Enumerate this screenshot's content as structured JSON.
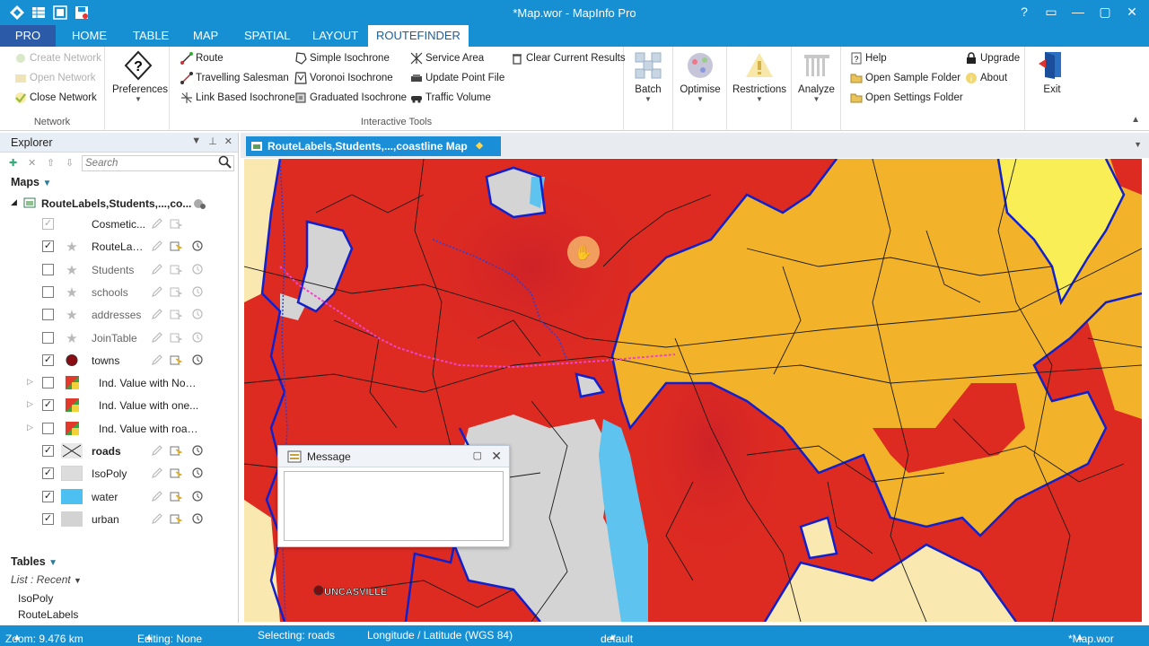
{
  "window": {
    "title": "*Map.wor - MapInfo Pro",
    "controls": [
      "?",
      "▭",
      "—",
      "▢",
      "✕"
    ]
  },
  "ribbon_tabs": [
    {
      "label": "PRO"
    },
    {
      "label": "HOME"
    },
    {
      "label": "TABLE"
    },
    {
      "label": "MAP"
    },
    {
      "label": "SPATIAL"
    },
    {
      "label": "LAYOUT"
    },
    {
      "label": "ROUTEFINDER",
      "active": true
    }
  ],
  "ribbon": {
    "network_group": {
      "label": "Network",
      "items": [
        {
          "label": "Create Network",
          "enabled": false
        },
        {
          "label": "Open Network",
          "enabled": false
        },
        {
          "label": "Close Network",
          "enabled": true
        }
      ]
    },
    "preferences": {
      "label": "Preferences"
    },
    "interactive_tools": {
      "label": "Interactive Tools",
      "col1": [
        "Route",
        "Travelling Salesman",
        "Link Based Isochrone"
      ],
      "col2": [
        "Simple Isochrone",
        "Voronoi Isochrone",
        "Graduated Isochrone"
      ],
      "col3": [
        "Service Area",
        "Update Point File",
        "Traffic Volume"
      ],
      "col4": [
        "Clear Current Results"
      ]
    },
    "big_buttons": [
      "Batch",
      "Optimise",
      "Restrictions",
      "Analyze"
    ],
    "help_group": {
      "col1": [
        "Help",
        "Open Sample Folder",
        "Open Settings Folder"
      ],
      "col2": [
        "Upgrade",
        "About"
      ]
    },
    "exit": {
      "label": "Exit"
    }
  },
  "explorer": {
    "title": "Explorer",
    "search_placeholder": "Search",
    "maps_label": "Maps",
    "map_name": "RouteLabels,Students,...,co...",
    "layers": [
      {
        "name": "Cosmetic...",
        "checked": true,
        "disabled": true,
        "swatch": "none"
      },
      {
        "name": "RouteLab...",
        "checked": true,
        "swatch": "star"
      },
      {
        "name": "Students",
        "checked": false,
        "swatch": "star"
      },
      {
        "name": "schools",
        "checked": false,
        "swatch": "star"
      },
      {
        "name": "addresses",
        "checked": false,
        "swatch": "star"
      },
      {
        "name": "JoinTable",
        "checked": false,
        "swatch": "star"
      },
      {
        "name": "towns",
        "checked": true,
        "swatch": "dot"
      },
      {
        "name": "Ind. Value with NoD...",
        "checked": false,
        "swatch": "theme",
        "theme": true
      },
      {
        "name": "Ind. Value with one...",
        "checked": true,
        "swatch": "theme",
        "theme": true
      },
      {
        "name": "Ind. Value with road...",
        "checked": false,
        "swatch": "theme",
        "theme": true
      },
      {
        "name": "roads",
        "checked": true,
        "swatch": "cross",
        "bold": true
      },
      {
        "name": "IsoPoly",
        "checked": true,
        "swatch": "fillgray"
      },
      {
        "name": "water",
        "checked": true,
        "swatch": "water"
      },
      {
        "name": "urban",
        "checked": true,
        "swatch": "urban"
      }
    ],
    "tables_label": "Tables",
    "list_label": "List : Recent",
    "tables": [
      "IsoPoly",
      "RouteLabels"
    ]
  },
  "map_window": {
    "tab_title": "RouteLabels,Students,...,coastline Map",
    "town_label": "UNCASVILLE",
    "colors": {
      "red": "#dd2b22",
      "orange": "#f2b32a",
      "yellow": "#f9ee55",
      "cream": "#f9e8b0",
      "urban": "#d4d4d4",
      "water": "#5ec4ef",
      "boundary": "#1020cc"
    }
  },
  "message_window": {
    "title": "Message"
  },
  "status_bar": {
    "zoom": "Zoom: 9.476 km",
    "editing": "Editing: None",
    "selecting": "Selecting: roads",
    "projection": "Longitude / Latitude (WGS 84)",
    "style": "default",
    "workspace": "*Map.wor"
  }
}
